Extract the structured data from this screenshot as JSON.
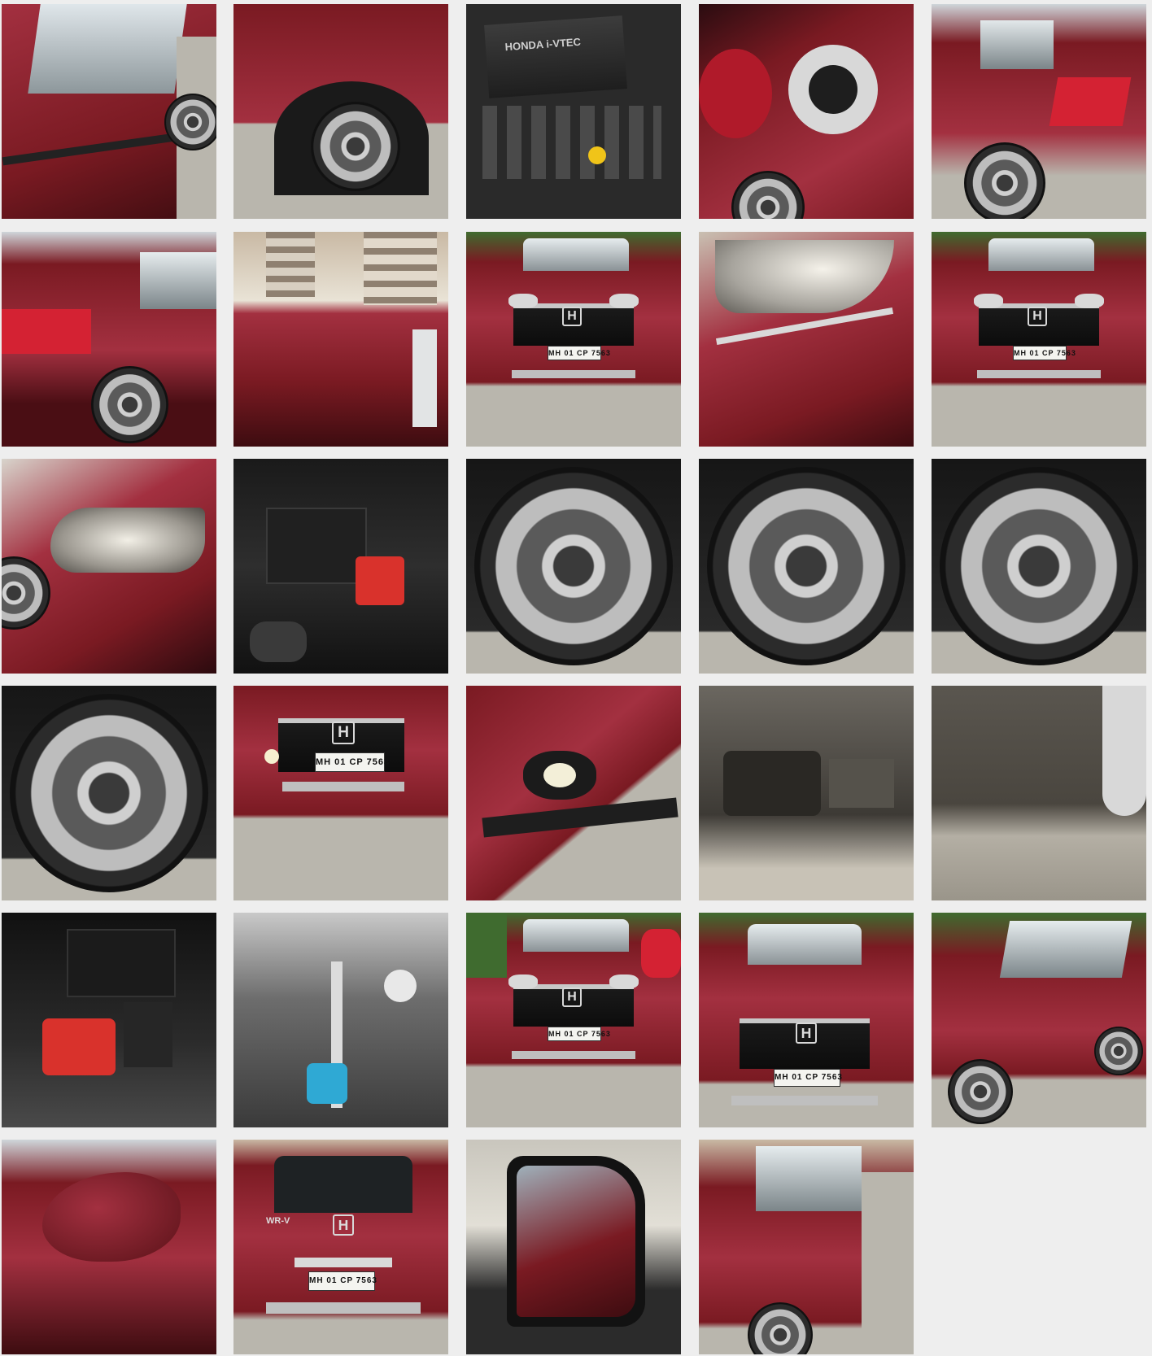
{
  "gallery": {
    "columns": 5,
    "tile_count": 29,
    "plate_text": "MH 01 CP 7563",
    "engine_badge": "HONDA i-VTEC",
    "rear_badge": "WR-V",
    "colors": {
      "background": "#eeeeee",
      "car_red": "#7a1a22",
      "car_red_light": "#a33040",
      "asphalt": "#b9b6ad",
      "tire": "#161616",
      "engine": "#2a2a2a",
      "building": "#c9b9a4",
      "plant": "#3f6b2f",
      "battery_red": "#d9322c",
      "coolant_blue": "#2fa9d4"
    },
    "tiles": [
      {
        "kind": "side-door",
        "name": "photo-side-door"
      },
      {
        "kind": "front-wheel-arch",
        "name": "photo-front-wheel-arch"
      },
      {
        "kind": "engine-cover",
        "name": "photo-engine-cover"
      },
      {
        "kind": "fuel-lid",
        "name": "photo-fuel-lid"
      },
      {
        "kind": "rear-quarter",
        "name": "photo-rear-quarter"
      },
      {
        "kind": "rear-side",
        "name": "photo-rear-side"
      },
      {
        "kind": "roof",
        "name": "photo-roof"
      },
      {
        "kind": "front",
        "name": "photo-front"
      },
      {
        "kind": "headlamp",
        "name": "photo-headlamp"
      },
      {
        "kind": "front",
        "name": "photo-front-2"
      },
      {
        "kind": "headlamp-side",
        "name": "photo-headlamp-side"
      },
      {
        "kind": "engine-bay",
        "name": "photo-engine-bay"
      },
      {
        "kind": "wheel",
        "name": "photo-wheel-1"
      },
      {
        "kind": "wheel",
        "name": "photo-wheel-2"
      },
      {
        "kind": "wheel",
        "name": "photo-wheel-3"
      },
      {
        "kind": "wheel",
        "name": "photo-wheel-4"
      },
      {
        "kind": "front-close",
        "name": "photo-front-close"
      },
      {
        "kind": "foglamp",
        "name": "photo-foglamp"
      },
      {
        "kind": "underbody",
        "name": "photo-underbody"
      },
      {
        "kind": "underbody-side",
        "name": "photo-underbody-side"
      },
      {
        "kind": "battery",
        "name": "photo-battery"
      },
      {
        "kind": "engine-bay-2",
        "name": "photo-engine-bay-2"
      },
      {
        "kind": "front-wide",
        "name": "photo-front-wide"
      },
      {
        "kind": "front-tall",
        "name": "photo-front-tall"
      },
      {
        "kind": "side-three-quarter",
        "name": "photo-side-three-quarter"
      },
      {
        "kind": "mirror",
        "name": "photo-mirror"
      },
      {
        "kind": "rear",
        "name": "photo-rear"
      },
      {
        "kind": "mirror-inside",
        "name": "photo-mirror-inside"
      },
      {
        "kind": "rear-door",
        "name": "photo-rear-door"
      }
    ]
  }
}
